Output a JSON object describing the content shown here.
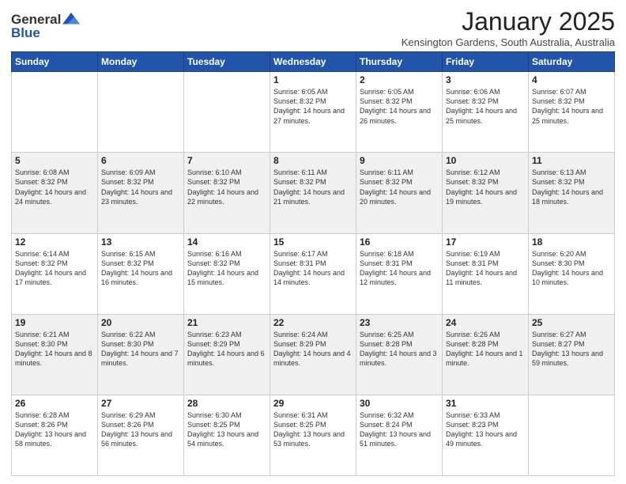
{
  "logo": {
    "general": "General",
    "blue": "Blue"
  },
  "header": {
    "title": "January 2025",
    "subtitle": "Kensington Gardens, South Australia, Australia"
  },
  "weekdays": [
    "Sunday",
    "Monday",
    "Tuesday",
    "Wednesday",
    "Thursday",
    "Friday",
    "Saturday"
  ],
  "weeks": [
    [
      {
        "day": "",
        "sunrise": "",
        "sunset": "",
        "daylight": ""
      },
      {
        "day": "",
        "sunrise": "",
        "sunset": "",
        "daylight": ""
      },
      {
        "day": "",
        "sunrise": "",
        "sunset": "",
        "daylight": ""
      },
      {
        "day": "1",
        "sunrise": "Sunrise: 6:05 AM",
        "sunset": "Sunset: 8:32 PM",
        "daylight": "Daylight: 14 hours and 27 minutes."
      },
      {
        "day": "2",
        "sunrise": "Sunrise: 6:05 AM",
        "sunset": "Sunset: 8:32 PM",
        "daylight": "Daylight: 14 hours and 26 minutes."
      },
      {
        "day": "3",
        "sunrise": "Sunrise: 6:06 AM",
        "sunset": "Sunset: 8:32 PM",
        "daylight": "Daylight: 14 hours and 25 minutes."
      },
      {
        "day": "4",
        "sunrise": "Sunrise: 6:07 AM",
        "sunset": "Sunset: 8:32 PM",
        "daylight": "Daylight: 14 hours and 25 minutes."
      }
    ],
    [
      {
        "day": "5",
        "sunrise": "Sunrise: 6:08 AM",
        "sunset": "Sunset: 8:32 PM",
        "daylight": "Daylight: 14 hours and 24 minutes."
      },
      {
        "day": "6",
        "sunrise": "Sunrise: 6:09 AM",
        "sunset": "Sunset: 8:32 PM",
        "daylight": "Daylight: 14 hours and 23 minutes."
      },
      {
        "day": "7",
        "sunrise": "Sunrise: 6:10 AM",
        "sunset": "Sunset: 8:32 PM",
        "daylight": "Daylight: 14 hours and 22 minutes."
      },
      {
        "day": "8",
        "sunrise": "Sunrise: 6:11 AM",
        "sunset": "Sunset: 8:32 PM",
        "daylight": "Daylight: 14 hours and 21 minutes."
      },
      {
        "day": "9",
        "sunrise": "Sunrise: 6:11 AM",
        "sunset": "Sunset: 8:32 PM",
        "daylight": "Daylight: 14 hours and 20 minutes."
      },
      {
        "day": "10",
        "sunrise": "Sunrise: 6:12 AM",
        "sunset": "Sunset: 8:32 PM",
        "daylight": "Daylight: 14 hours and 19 minutes."
      },
      {
        "day": "11",
        "sunrise": "Sunrise: 6:13 AM",
        "sunset": "Sunset: 8:32 PM",
        "daylight": "Daylight: 14 hours and 18 minutes."
      }
    ],
    [
      {
        "day": "12",
        "sunrise": "Sunrise: 6:14 AM",
        "sunset": "Sunset: 8:32 PM",
        "daylight": "Daylight: 14 hours and 17 minutes."
      },
      {
        "day": "13",
        "sunrise": "Sunrise: 6:15 AM",
        "sunset": "Sunset: 8:32 PM",
        "daylight": "Daylight: 14 hours and 16 minutes."
      },
      {
        "day": "14",
        "sunrise": "Sunrise: 6:16 AM",
        "sunset": "Sunset: 8:32 PM",
        "daylight": "Daylight: 14 hours and 15 minutes."
      },
      {
        "day": "15",
        "sunrise": "Sunrise: 6:17 AM",
        "sunset": "Sunset: 8:31 PM",
        "daylight": "Daylight: 14 hours and 14 minutes."
      },
      {
        "day": "16",
        "sunrise": "Sunrise: 6:18 AM",
        "sunset": "Sunset: 8:31 PM",
        "daylight": "Daylight: 14 hours and 12 minutes."
      },
      {
        "day": "17",
        "sunrise": "Sunrise: 6:19 AM",
        "sunset": "Sunset: 8:31 PM",
        "daylight": "Daylight: 14 hours and 11 minutes."
      },
      {
        "day": "18",
        "sunrise": "Sunrise: 6:20 AM",
        "sunset": "Sunset: 8:30 PM",
        "daylight": "Daylight: 14 hours and 10 minutes."
      }
    ],
    [
      {
        "day": "19",
        "sunrise": "Sunrise: 6:21 AM",
        "sunset": "Sunset: 8:30 PM",
        "daylight": "Daylight: 14 hours and 8 minutes."
      },
      {
        "day": "20",
        "sunrise": "Sunrise: 6:22 AM",
        "sunset": "Sunset: 8:30 PM",
        "daylight": "Daylight: 14 hours and 7 minutes."
      },
      {
        "day": "21",
        "sunrise": "Sunrise: 6:23 AM",
        "sunset": "Sunset: 8:29 PM",
        "daylight": "Daylight: 14 hours and 6 minutes."
      },
      {
        "day": "22",
        "sunrise": "Sunrise: 6:24 AM",
        "sunset": "Sunset: 8:29 PM",
        "daylight": "Daylight: 14 hours and 4 minutes."
      },
      {
        "day": "23",
        "sunrise": "Sunrise: 6:25 AM",
        "sunset": "Sunset: 8:28 PM",
        "daylight": "Daylight: 14 hours and 3 minutes."
      },
      {
        "day": "24",
        "sunrise": "Sunrise: 6:26 AM",
        "sunset": "Sunset: 8:28 PM",
        "daylight": "Daylight: 14 hours and 1 minute."
      },
      {
        "day": "25",
        "sunrise": "Sunrise: 6:27 AM",
        "sunset": "Sunset: 8:27 PM",
        "daylight": "Daylight: 13 hours and 59 minutes."
      }
    ],
    [
      {
        "day": "26",
        "sunrise": "Sunrise: 6:28 AM",
        "sunset": "Sunset: 8:26 PM",
        "daylight": "Daylight: 13 hours and 58 minutes."
      },
      {
        "day": "27",
        "sunrise": "Sunrise: 6:29 AM",
        "sunset": "Sunset: 8:26 PM",
        "daylight": "Daylight: 13 hours and 56 minutes."
      },
      {
        "day": "28",
        "sunrise": "Sunrise: 6:30 AM",
        "sunset": "Sunset: 8:25 PM",
        "daylight": "Daylight: 13 hours and 54 minutes."
      },
      {
        "day": "29",
        "sunrise": "Sunrise: 6:31 AM",
        "sunset": "Sunset: 8:25 PM",
        "daylight": "Daylight: 13 hours and 53 minutes."
      },
      {
        "day": "30",
        "sunrise": "Sunrise: 6:32 AM",
        "sunset": "Sunset: 8:24 PM",
        "daylight": "Daylight: 13 hours and 51 minutes."
      },
      {
        "day": "31",
        "sunrise": "Sunrise: 6:33 AM",
        "sunset": "Sunset: 8:23 PM",
        "daylight": "Daylight: 13 hours and 49 minutes."
      },
      {
        "day": "",
        "sunrise": "",
        "sunset": "",
        "daylight": ""
      }
    ]
  ]
}
